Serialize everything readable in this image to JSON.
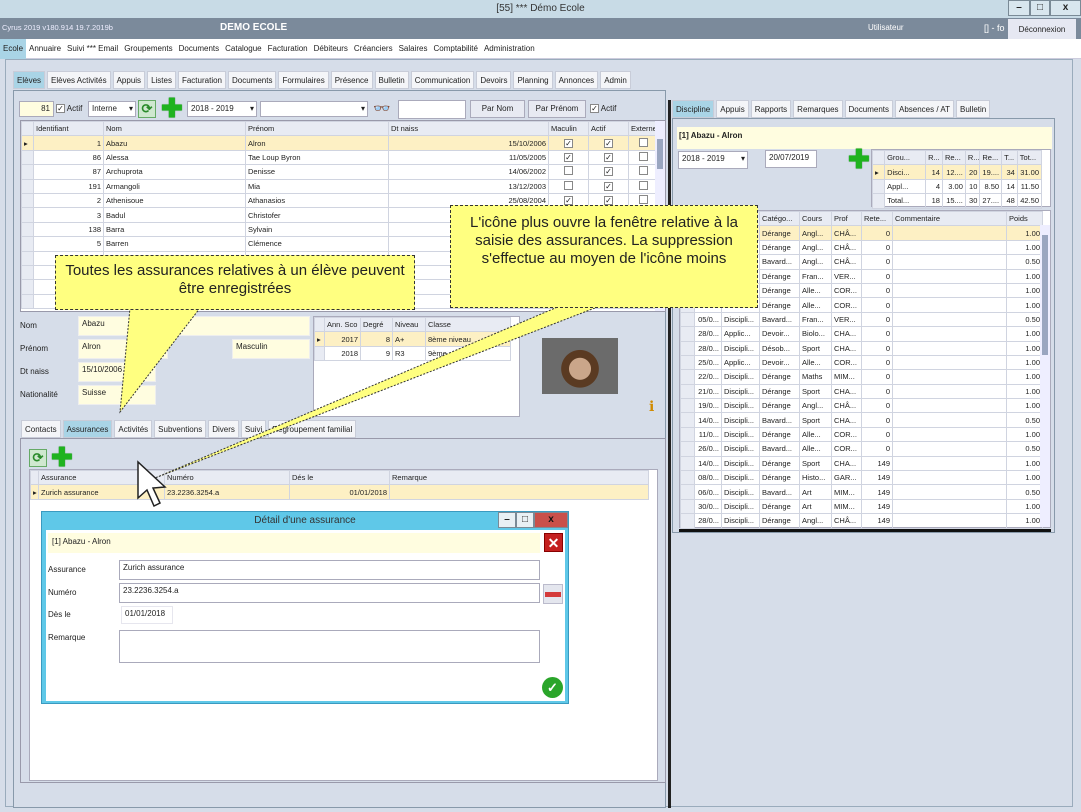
{
  "window": {
    "title": "[55] *** Démo Ecole",
    "min": "–",
    "max": "□",
    "close": "x"
  },
  "header": {
    "version": "Cyrus 2019 v180.914 19.7.2019b",
    "school": "DEMO ECOLE",
    "user_label": "Utilisateur",
    "user_value": "[] - fo",
    "logout": "Déconnexion"
  },
  "menu": [
    "Ecole",
    "Annuaire",
    "Suivi *** Email",
    "Groupements",
    "Documents",
    "Catalogue",
    "Facturation",
    "Débiteurs",
    "Créanciers",
    "Salaires",
    "Comptabilité",
    "Administration"
  ],
  "subtabs": [
    "Elèves",
    "Elèves Activités",
    "Appuis",
    "Listes",
    "Facturation",
    "Documents",
    "Formulaires",
    "Présence",
    "Bulletin",
    "Communication",
    "Devoirs",
    "Planning",
    "Annonces",
    "Admin"
  ],
  "toolbar": {
    "count": "81",
    "actif1": "Actif",
    "type": "Interne",
    "year": "2018 - 2019",
    "filter": "",
    "search": "",
    "by_name": "Par Nom",
    "by_firstname": "Par Prénom",
    "actif2": "Actif"
  },
  "students": {
    "columns": [
      "Identifiant",
      "Nom",
      "Prénom",
      "Dt naiss",
      "Maculin",
      "Actif",
      "Externe"
    ],
    "rows": [
      [
        "1",
        "Abazu",
        "Alron",
        "15/10/2006",
        true,
        true,
        false
      ],
      [
        "86",
        "Alessa",
        "Tae Loup Byron",
        "11/05/2005",
        true,
        true,
        false
      ],
      [
        "87",
        "Archuprota",
        "Denisse",
        "14/06/2002",
        false,
        true,
        false
      ],
      [
        "191",
        "Armangoli",
        "Mia",
        "13/12/2003",
        false,
        true,
        false
      ],
      [
        "2",
        "Athenisoue",
        "Athanasios",
        "25/08/2004",
        true,
        true,
        false
      ],
      [
        "3",
        "Badul",
        "Christofer",
        "",
        false,
        false,
        false
      ],
      [
        "138",
        "Barra",
        "Sylvain",
        "",
        false,
        false,
        false
      ],
      [
        "5",
        "Barren",
        "Clémence",
        "",
        false,
        false,
        false
      ]
    ]
  },
  "details": {
    "nom_label": "Nom",
    "nom": "Abazu",
    "prenom_label": "Prénom",
    "prenom": "Alron",
    "dtnaiss_label": "Dt naiss",
    "dtnaiss": "15/10/2006",
    "nat_label": "Nationalité",
    "nat": "Suisse",
    "sexe": "Masculin"
  },
  "classes": {
    "columns": [
      "Ann. Sco",
      "Degré",
      "Niveau",
      "Classe"
    ],
    "rows": [
      [
        "2017",
        "8",
        "A+",
        "8ème niveau"
      ],
      [
        "2018",
        "9",
        "R3",
        "9ème"
      ]
    ]
  },
  "lowertabs": [
    "Contacts",
    "Assurances",
    "Activités",
    "Subventions",
    "Divers",
    "Suivi",
    "Regroupement familial"
  ],
  "insurances": {
    "columns": [
      "Assurance",
      "Numéro",
      "Dés le",
      "Remarque"
    ],
    "rows": [
      [
        "Zurich assurance",
        "23.2236.3254.a",
        "01/01/2018",
        ""
      ]
    ]
  },
  "dialog": {
    "title": "Détail d'une assurance",
    "student": "[1] Abazu - Alron",
    "assurance_label": "Assurance",
    "assurance": "Zurich assurance",
    "numero_label": "Numéro",
    "numero": "23.2236.3254.a",
    "des_label": "Dès le",
    "des": "01/01/2018",
    "remarque_label": "Remarque",
    "remarque": ""
  },
  "right": {
    "tabs": [
      "Discipline",
      "Appuis",
      "Rapports",
      "Remarques",
      "Documents",
      "Absences / AT",
      "Bulletin"
    ],
    "student": "[1] Abazu - Alron",
    "year": "2018 - 2019",
    "date": "20/07/2019",
    "summary": {
      "columns": [
        "Grou...",
        "R...",
        "Re...",
        "R...",
        "Re...",
        "T...",
        "Tot..."
      ],
      "rows": [
        [
          "Disci...",
          "14",
          "12....",
          "20",
          "19....",
          "34",
          "31.00"
        ],
        [
          "Appl...",
          "4",
          "3.00",
          "10",
          "8.50",
          "14",
          "11.50"
        ],
        [
          "Total...",
          "18",
          "15....",
          "30",
          "27....",
          "48",
          "42.50"
        ]
      ]
    },
    "events": {
      "columns": [
        "",
        "",
        "Catégo...",
        "Cours",
        "Prof",
        "Rete...",
        "Commentaire",
        "Poids"
      ],
      "rows": [
        [
          "",
          "",
          "Dérange",
          "Angl...",
          "CHÂ...",
          "0",
          "",
          "1.00"
        ],
        [
          "",
          "",
          "Dérange",
          "Angl...",
          "CHÂ...",
          "0",
          "",
          "1.00"
        ],
        [
          "",
          "",
          "Bavard...",
          "Angl...",
          "CHÂ...",
          "0",
          "",
          "0.50"
        ],
        [
          "",
          "",
          "Dérange",
          "Fran...",
          "VER...",
          "0",
          "",
          "1.00"
        ],
        [
          "",
          "",
          "Dérange",
          "Alle...",
          "COR...",
          "0",
          "",
          "1.00"
        ],
        [
          "",
          "",
          "Dérange",
          "Alle...",
          "COR...",
          "0",
          "",
          "1.00"
        ],
        [
          "05/0...",
          "Discipli...",
          "Bavard...",
          "Fran...",
          "VER...",
          "0",
          "",
          "0.50"
        ],
        [
          "28/0...",
          "Applic...",
          "Devoir...",
          "Biolo...",
          "CHA...",
          "0",
          "",
          "1.00"
        ],
        [
          "28/0...",
          "Discipli...",
          "Désob...",
          "Sport",
          "CHA...",
          "0",
          "",
          "1.00"
        ],
        [
          "25/0...",
          "Applic...",
          "Devoir...",
          "Alle...",
          "COR...",
          "0",
          "",
          "1.00"
        ],
        [
          "22/0...",
          "Discipli...",
          "Dérange",
          "Maths",
          "MIM...",
          "0",
          "",
          "1.00"
        ],
        [
          "21/0...",
          "Discipli...",
          "Dérange",
          "Sport",
          "CHA...",
          "0",
          "",
          "1.00"
        ],
        [
          "19/0...",
          "Discipli...",
          "Dérange",
          "Angl...",
          "CHÂ...",
          "0",
          "",
          "1.00"
        ],
        [
          "14/0...",
          "Discipli...",
          "Bavard...",
          "Sport",
          "CHA...",
          "0",
          "",
          "0.50"
        ],
        [
          "11/0...",
          "Discipli...",
          "Dérange",
          "Alle...",
          "COR...",
          "0",
          "",
          "1.00"
        ],
        [
          "26/0...",
          "Discipli...",
          "Bavard...",
          "Alle...",
          "COR...",
          "0",
          "",
          "0.50"
        ],
        [
          "14/0...",
          "Discipli...",
          "Dérange",
          "Sport",
          "CHA...",
          "149",
          "",
          "1.00"
        ],
        [
          "08/0...",
          "Discipli...",
          "Dérange",
          "Histo...",
          "GAR...",
          "149",
          "",
          "1.00"
        ],
        [
          "06/0...",
          "Discipli...",
          "Bavard...",
          "Art",
          "MIM...",
          "149",
          "",
          "0.50"
        ],
        [
          "30/0...",
          "Discipli...",
          "Dérange",
          "Art",
          "MIM...",
          "149",
          "",
          "1.00"
        ],
        [
          "28/0...",
          "Discipli...",
          "Dérange",
          "Angl...",
          "CHÂ...",
          "149",
          "",
          "1.00"
        ]
      ]
    }
  },
  "callouts": {
    "left": "Toutes les assurances relatives à un élève peuvent être enregistrées",
    "right": "L'icône plus ouvre la fenêtre relative à la saisie des assurances. La suppression s'effectue au moyen de l'icône moins"
  },
  "colors": {
    "accent_tab": "#a9d4e6",
    "header": "#7b8a9b",
    "callout": "#ffff80",
    "dialog_frame": "#5fc8e8",
    "selected_row": "#fdf0c4"
  }
}
